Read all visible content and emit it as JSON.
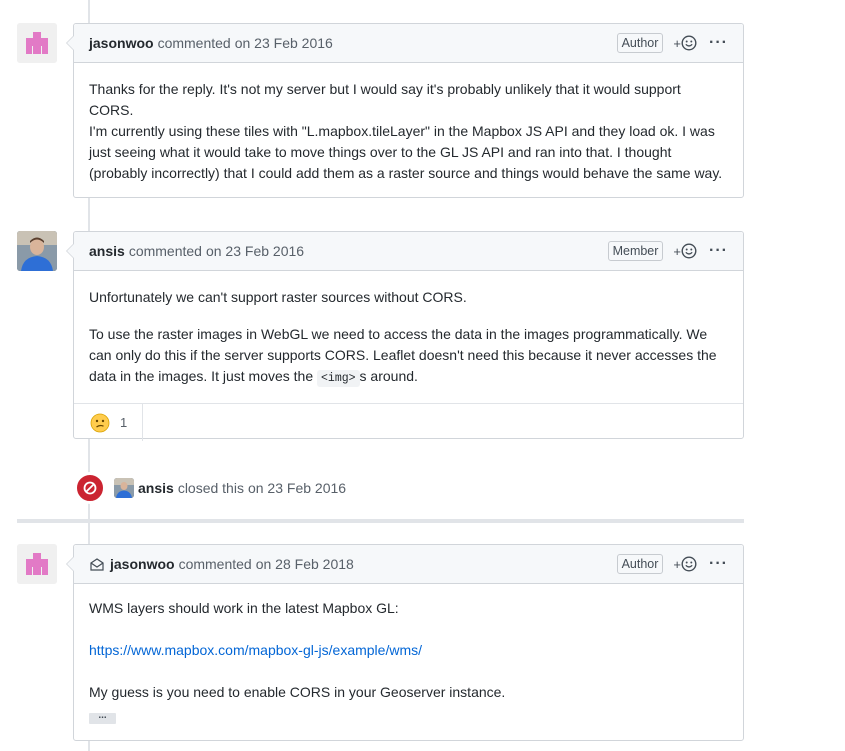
{
  "comments": [
    {
      "author": "jasonwoo",
      "action": "commented",
      "date": "on 23 Feb 2016",
      "role": "Author",
      "paragraphs": [
        "Thanks for the reply. It's not my server but I would say it's probably unlikely that it would support CORS.",
        "I'm currently using these tiles with \"L.mapbox.tileLayer\" in the Mapbox JS API and they load ok. I was just seeing what it would take to move things over to the GL JS API and ran into that. I thought (probably incorrectly) that I could add them as a raster source and things would behave the same way."
      ]
    },
    {
      "author": "ansis",
      "action": "commented",
      "date": "on 23 Feb 2016",
      "role": "Member",
      "paragraphs": [
        "Unfortunately we can't support raster sources without CORS.",
        "To use the raster images in WebGL we need to access the data in the images programmatically. We can only do this if the server supports CORS. Leaflet doesn't need this because it never accesses the data in the images. It just moves the",
        "<img>",
        "s around."
      ],
      "reaction_count": "1"
    },
    {
      "author": "jasonwoo",
      "action": "commented",
      "date": "on 28 Feb 2018",
      "role": "Author",
      "paragraphs": [
        "WMS layers should work in the latest Mapbox GL:",
        "https://www.mapbox.com/mapbox-gl-js/example/wms/",
        "My guess is you need to enable CORS in your Geoserver instance."
      ],
      "hidden_text_label": "..."
    }
  ],
  "event": {
    "actor": "ansis",
    "text": "closed this",
    "date": "on 23 Feb 2016"
  },
  "icons": {
    "reaction": "smiley-icon",
    "more": "kebab-horizontal-icon",
    "closed": "circle-slash-icon",
    "email": "mail-icon",
    "confused": "confused-face-icon"
  },
  "colors": {
    "link": "#0366d6",
    "closed_badge": "#cb2431",
    "identicon_pink": "#e27ac6"
  }
}
